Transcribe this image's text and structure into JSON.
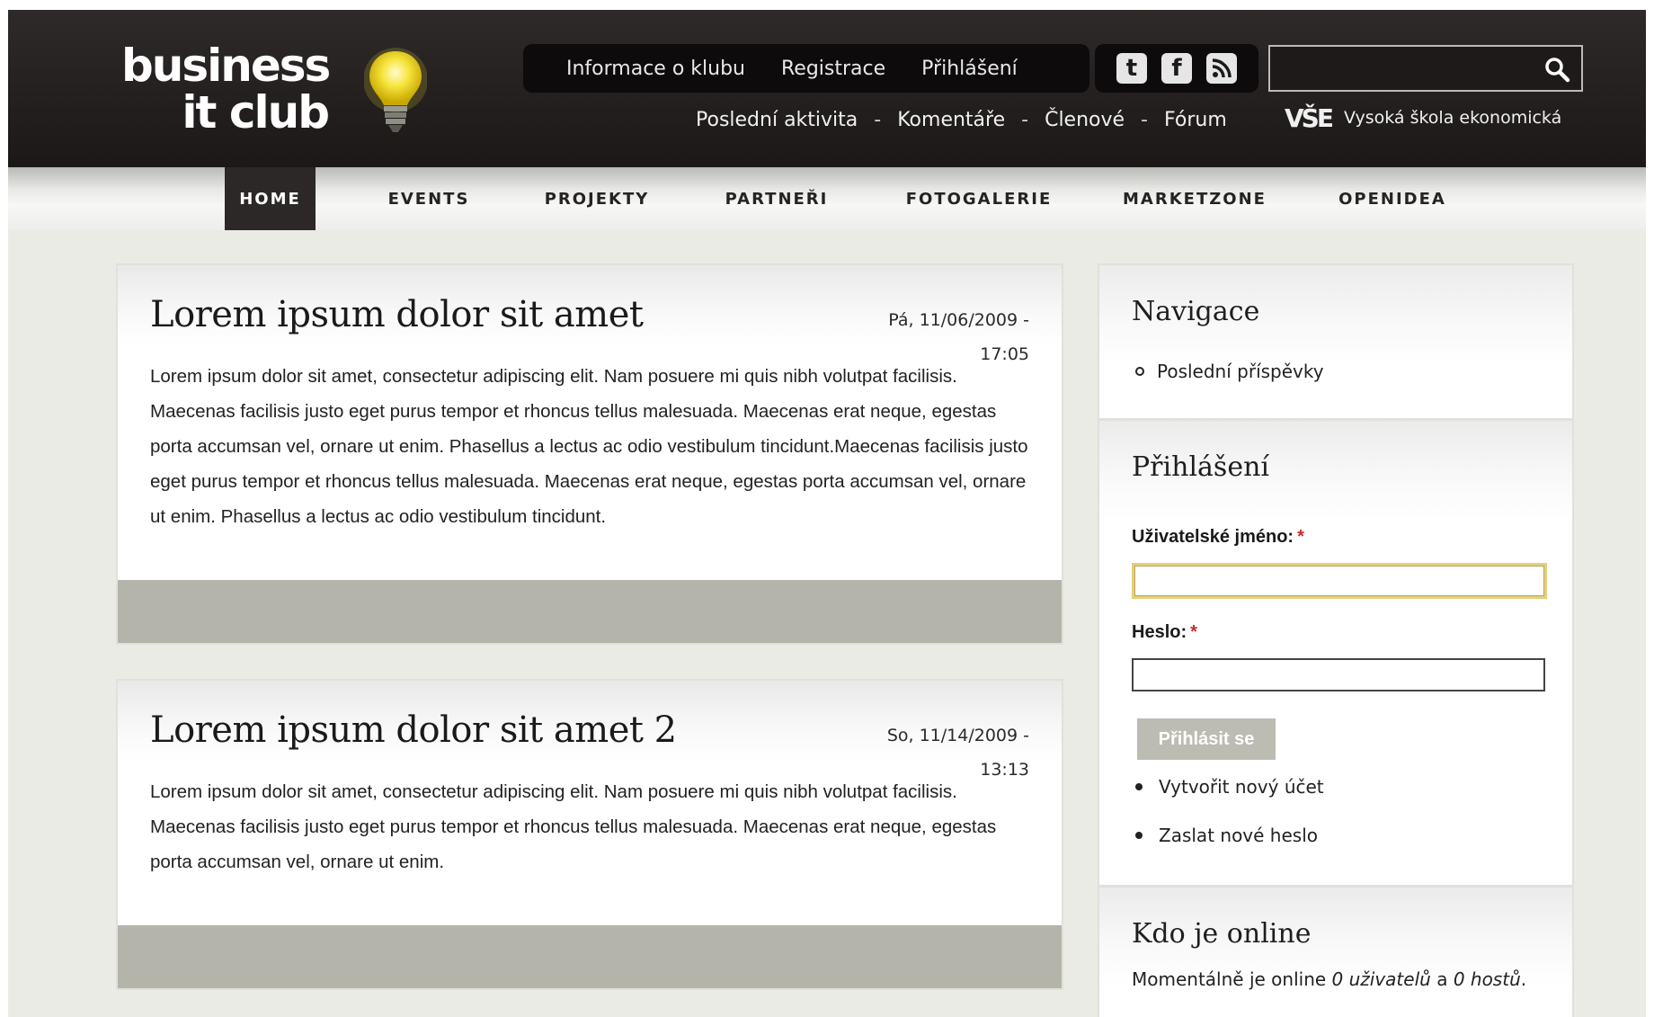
{
  "logo": {
    "line1": "business",
    "line2": "it club"
  },
  "top_nav": [
    "Informace o klubu",
    "Registrace",
    "Přihlášení"
  ],
  "social": [
    {
      "icon": "twitter-icon",
      "glyph": "t"
    },
    {
      "icon": "facebook-icon",
      "glyph": "f"
    },
    {
      "icon": "rss-icon",
      "glyph": "rss"
    }
  ],
  "search": {
    "value": "",
    "placeholder": ""
  },
  "sub_nav": [
    "Poslední aktivita",
    "Komentáře",
    "Členové",
    "Fórum"
  ],
  "sub_nav_separator": "-",
  "vse": {
    "mark": "VŠE",
    "name": "Vysoká škola ekonomická"
  },
  "menu": [
    "HOME",
    "EVENTS",
    "PROJEKTY",
    "PARTNEŘI",
    "FOTOGALERIE",
    "MARKETZONE",
    "OPENIDEA"
  ],
  "posts": [
    {
      "title": "Lorem ipsum dolor sit amet",
      "date_line1": "Pá, 11/06/2009 -",
      "date_line2": "17:05",
      "body": "Lorem ipsum dolor sit amet, consectetur adipiscing elit. Nam posuere mi quis nibh volutpat facilisis. Maecenas facilisis justo eget purus tempor et rhoncus tellus malesuada. Maecenas erat neque, egestas porta accumsan vel, ornare ut enim. Phasellus a lectus ac odio vestibulum tincidunt.Maecenas facilisis justo eget purus tempor et rhoncus tellus malesuada. Maecenas erat neque, egestas porta accumsan vel, ornare ut enim. Phasellus a lectus ac odio vestibulum tincidunt."
    },
    {
      "title": "Lorem ipsum dolor sit amet 2",
      "date_line1": "So, 11/14/2009 -",
      "date_line2": "13:13",
      "body": "Lorem ipsum dolor sit amet, consectetur adipiscing elit. Nam posuere mi quis nibh volutpat facilisis. Maecenas facilisis justo eget purus tempor et rhoncus tellus malesuada. Maecenas erat neque, egestas porta accumsan vel, ornare ut enim."
    }
  ],
  "sidebar": {
    "navigation": {
      "title": "Navigace",
      "items": [
        "Poslední příspěvky"
      ]
    },
    "login": {
      "title": "Přihlášení",
      "username_label": "Uživatelské jméno:",
      "password_label": "Heslo:",
      "required_mark": "*",
      "submit_label": "Přihlásit se",
      "links": [
        "Vytvořit nový účet",
        "Zaslat nové heslo"
      ]
    },
    "online": {
      "title": "Kdo je online",
      "prefix": "Momentálně je online",
      "users": "0 uživatelů",
      "conj": "a",
      "guests": "0 hostů",
      "suffix": "."
    }
  }
}
